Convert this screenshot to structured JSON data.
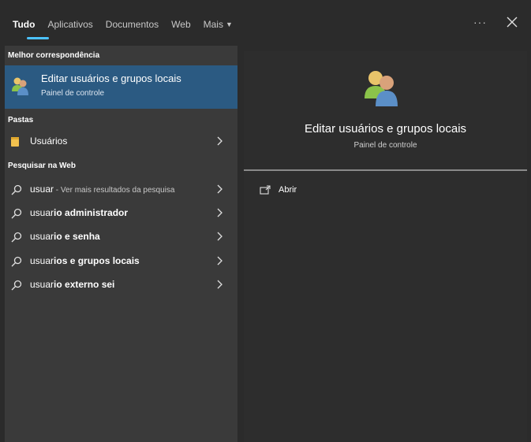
{
  "tabs": [
    {
      "label": "Tudo",
      "active": true
    },
    {
      "label": "Aplicativos"
    },
    {
      "label": "Documentos"
    },
    {
      "label": "Web"
    },
    {
      "label": "Mais"
    }
  ],
  "top_actions": {
    "more_label": "···"
  },
  "left": {
    "best_match_heading": "Melhor correspondência",
    "best_match": {
      "title": "Editar usuários e grupos locais",
      "subtitle": "Painel de controle",
      "icon": "users-group-icon"
    },
    "folders_heading": "Pastas",
    "folders": [
      {
        "label": "Usuários",
        "icon": "folder-icon"
      }
    ],
    "web_heading": "Pesquisar na Web",
    "web_results": [
      {
        "prefix": "usuar",
        "bold": "",
        "hint": " - Ver mais resultados da pesquisa"
      },
      {
        "prefix": "usuar",
        "bold": "io administrador",
        "hint": ""
      },
      {
        "prefix": "usuar",
        "bold": "io e senha",
        "hint": ""
      },
      {
        "prefix": "usuar",
        "bold": "ios e grupos locais",
        "hint": ""
      },
      {
        "prefix": "usuar",
        "bold": "io externo sei",
        "hint": ""
      }
    ]
  },
  "right": {
    "title": "Editar usuários e grupos locais",
    "subtitle": "Painel de controle",
    "actions": [
      {
        "label": "Abrir",
        "icon": "open-window-icon"
      }
    ]
  },
  "colors": {
    "accent": "#4cc2ff",
    "selected": "#2b5a82",
    "panel": "#3a3a3a",
    "background": "#2b2b2b"
  }
}
